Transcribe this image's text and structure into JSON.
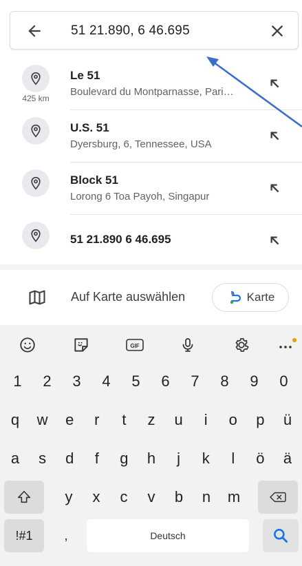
{
  "search": {
    "query": "51 21.890, 6 46.695"
  },
  "suggestions": [
    {
      "title": "Le 51",
      "subtitle": "Boulevard du Montparnasse, Pari…",
      "distance": "425 km"
    },
    {
      "title": "U.S. 51",
      "subtitle": "Dyersburg, 6, Tennessee, USA",
      "distance": ""
    },
    {
      "title": "Block 51",
      "subtitle": "Lorong 6 Toa Payoh, Singapur",
      "distance": ""
    },
    {
      "title": "51 21.890 6 46.695",
      "subtitle": "",
      "distance": ""
    }
  ],
  "map_select": {
    "label": "Auf Karte auswählen",
    "chip_label": "Karte"
  },
  "keyboard": {
    "toolbar": [
      "emoji-icon",
      "sticker-icon",
      "gif-icon",
      "microphone-icon",
      "settings-icon",
      "more-icon"
    ],
    "gif_label": "GIF",
    "number_row": [
      "1",
      "2",
      "3",
      "4",
      "5",
      "6",
      "7",
      "8",
      "9",
      "0"
    ],
    "row1": [
      "q",
      "w",
      "e",
      "r",
      "t",
      "z",
      "u",
      "i",
      "o",
      "p",
      "ü"
    ],
    "row2": [
      "a",
      "s",
      "d",
      "f",
      "g",
      "h",
      "j",
      "k",
      "l",
      "ö",
      "ä"
    ],
    "row3": [
      "y",
      "x",
      "c",
      "v",
      "b",
      "n",
      "m"
    ],
    "symbols_label": "!#1",
    "comma_label": ",",
    "space_label": "Deutsch",
    "period_label": ".",
    "accent_color": "#1a73e8",
    "notify_dot_color": "#f29900"
  },
  "annotation_arrow_color": "#3a6fc9"
}
